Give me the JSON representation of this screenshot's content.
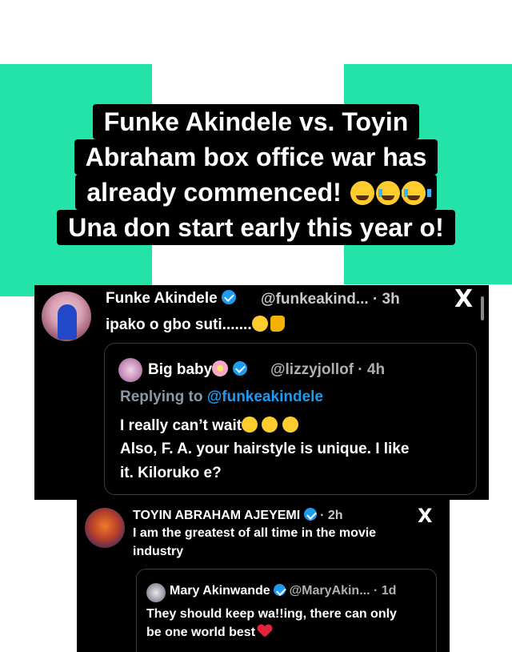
{
  "caption": {
    "line1": "Funke Akindele vs. Toyin",
    "line2": "Abraham box office war has",
    "line3": "already commenced!",
    "line3_emojis": [
      "laughing-crying-emoji",
      "crying-emoji",
      "crying-emoji"
    ],
    "line4": "Una don start early this year o!"
  },
  "tweet1": {
    "name": "Funke Akindele",
    "handle_time": "@funkeakind... · 3h",
    "close": "X",
    "text": "ipako o gbo suti.......",
    "text_emojis": [
      "kiss-emoji",
      "thumbs-up-emoji"
    ],
    "quote": {
      "name": "Big baby",
      "handle_time": "@lizzyjollof · 4h",
      "replying_prefix": "Replying to",
      "replying_handle": "@funkeakindele",
      "line1": "I really can’t wait",
      "line2": "Also, F. A. your hairstyle is unique. I like",
      "line3": "it. Kiloruko e?"
    }
  },
  "tweet2": {
    "name": "TOYIN ABRAHAM AJEYEMI",
    "time": "· 2h",
    "close": "X",
    "line1": "I am the greatest of all time in the  movie",
    "line2": "industry",
    "quote": {
      "name": "Mary Akinwande",
      "handle_time": "@MaryAkin... · 1d",
      "line1": "They should keep wa!!ing,  there can only",
      "line2": "be one world best"
    }
  },
  "colors": {
    "flag_green": "#23e3a8",
    "verified_blue": "#1d9bf0",
    "card_bg": "#000000"
  }
}
